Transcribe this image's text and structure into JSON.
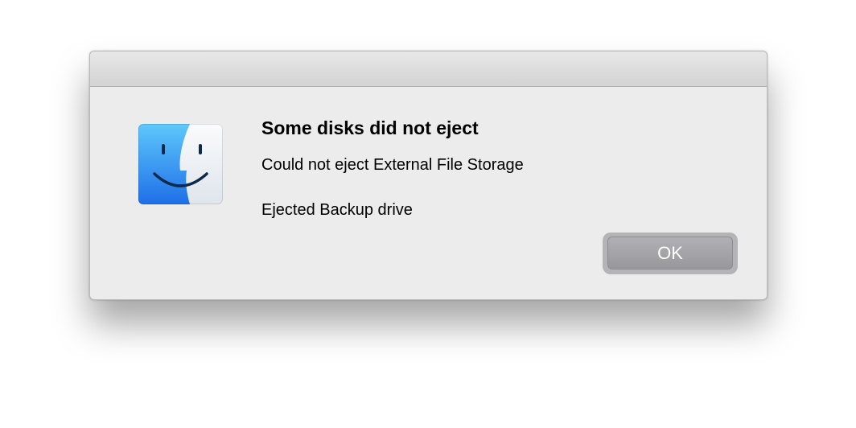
{
  "dialog": {
    "title": "Some disks did not eject",
    "messages": [
      "Could not eject External File Storage",
      "Ejected Backup drive"
    ],
    "icon": "finder-icon",
    "buttons": {
      "ok_label": "OK"
    }
  },
  "colors": {
    "dialog_background": "#ececec",
    "finder_blue": "#2f8cf0",
    "finder_light": "#eef1f5",
    "button_gray": "#a4a3a8"
  }
}
